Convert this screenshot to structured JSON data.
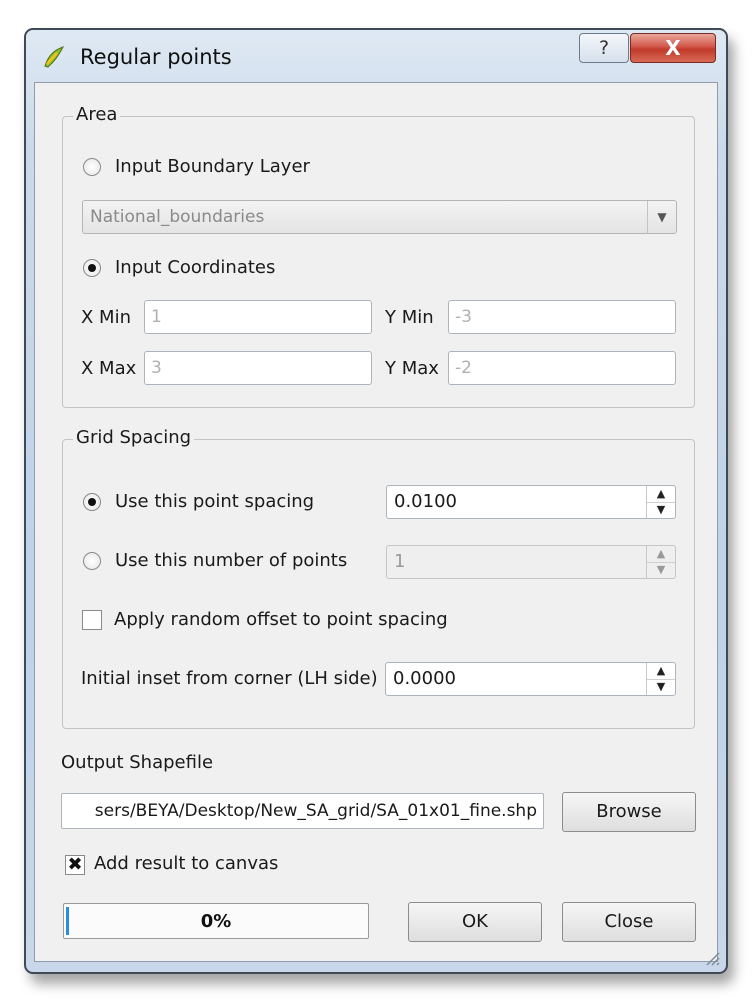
{
  "window": {
    "title": "Regular points",
    "help_glyph": "?",
    "close_glyph": "X"
  },
  "area": {
    "legend": "Area",
    "boundary_label": "Input Boundary Layer",
    "boundary_selected": false,
    "layer_combo_value": "National_boundaries",
    "coords_label": "Input Coordinates",
    "coords_selected": true,
    "xmin_label": "X Min",
    "xmin_value": "1",
    "ymin_label": "Y Min",
    "ymin_value": "-3",
    "xmax_label": "X Max",
    "xmax_value": "3",
    "ymax_label": "Y Max",
    "ymax_value": "-2"
  },
  "grid": {
    "legend": "Grid Spacing",
    "spacing_label": "Use this point spacing",
    "spacing_selected": true,
    "spacing_value": "0.0100",
    "points_label": "Use this number of points",
    "points_selected": false,
    "points_value": "1",
    "random_offset_label": "Apply random offset to point spacing",
    "random_offset_checked": false,
    "inset_label": "Initial inset from corner (LH side)",
    "inset_value": "0.0000"
  },
  "output": {
    "label": "Output Shapefile",
    "path": "sers/BEYA/Desktop/New_SA_grid/SA_01x01_fine.shp",
    "browse_label": "Browse",
    "add_to_canvas_label": "Add result to canvas",
    "add_to_canvas_checked": true,
    "check_glyph": "✖"
  },
  "footer": {
    "progress_text": "0%",
    "progress_fraction": 0.0,
    "ok_label": "OK",
    "close_label": "Close"
  },
  "colors": {
    "accent": "#2a8fdc",
    "close_button": "#c13a2b",
    "dialog_bg": "#f0f0f0"
  }
}
